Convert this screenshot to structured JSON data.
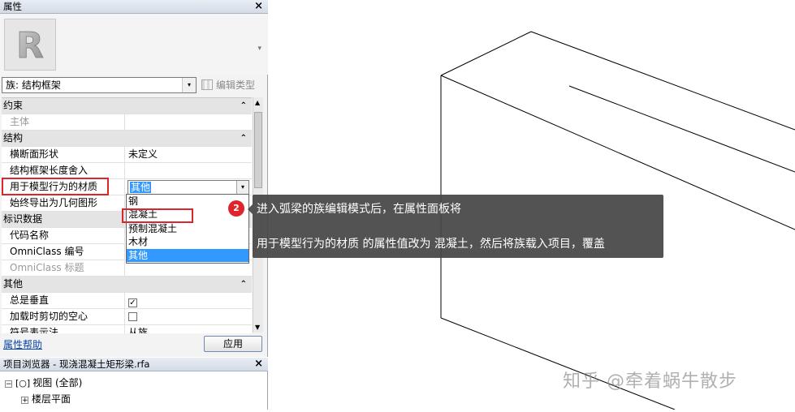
{
  "properties_panel": {
    "title": "属性",
    "close_glyph": "×",
    "logo_letter": "R",
    "logo_scroll_glyph": "▾",
    "family_selector": "族: 结构框架",
    "family_dropdown_glyph": "▾",
    "edit_type_label": "编辑类型",
    "sections": {
      "constraints": {
        "label": "约束",
        "collapse_glyph": "⌃",
        "rows": {
          "host": {
            "key": "主体",
            "value": ""
          }
        }
      },
      "structure": {
        "label": "结构",
        "collapse_glyph": "⌃",
        "rows": {
          "section_shape": {
            "key": "横断面形状",
            "value": "未定义"
          },
          "cut_length": {
            "key": "结构框架长度舍入",
            "value": ""
          },
          "material_for_model_behavior": {
            "key": "用于模型行为的材质",
            "value": "其他"
          },
          "export_as_geometry": {
            "key": "始终导出为几何图形",
            "value": ""
          }
        }
      },
      "identity": {
        "label": "标识数据",
        "rows": {
          "keynote": {
            "key": "代码名称",
            "value": ""
          },
          "omniclass_number": {
            "key": "OmniClass 编号",
            "value": ""
          },
          "omniclass_title": {
            "key": "OmniClass 标题",
            "value": ""
          }
        }
      },
      "other": {
        "label": "其他",
        "collapse_glyph": "⌃",
        "rows": {
          "always_vertical": {
            "key": "总是垂直",
            "checked": true,
            "check_glyph": "✓"
          },
          "cut_with_voids": {
            "key": "加载时剪切的空心",
            "checked": false
          },
          "symbolic_representation": {
            "key": "符号表示法",
            "value": "从族"
          }
        }
      }
    },
    "material_dropdown": {
      "options": [
        "钢",
        "混凝土",
        "预制混凝土",
        "木材",
        "其他"
      ],
      "selected": "其他"
    },
    "help_link": "属性帮助",
    "apply_button": "应用"
  },
  "project_browser": {
    "title": "项目浏览器 - 现浇混凝土矩形梁.rfa",
    "close_glyph": "×",
    "tree": [
      {
        "toggle": "−",
        "label": "视图 (全部)"
      },
      {
        "toggle": "+",
        "label": "楼层平面"
      }
    ]
  },
  "annotation": {
    "step_number": "2",
    "line1": "进入弧梁的族编辑模式后，在属性面板将",
    "line2": "用于模型行为的材质 的属性值改为 混凝土，然后将族载入项目，覆盖"
  },
  "watermark": "知乎 @牵着蜗牛散步",
  "colors": {
    "highlight": "#3399ff",
    "annotation_red": "#e0242b",
    "callout_bg": "#464646"
  }
}
